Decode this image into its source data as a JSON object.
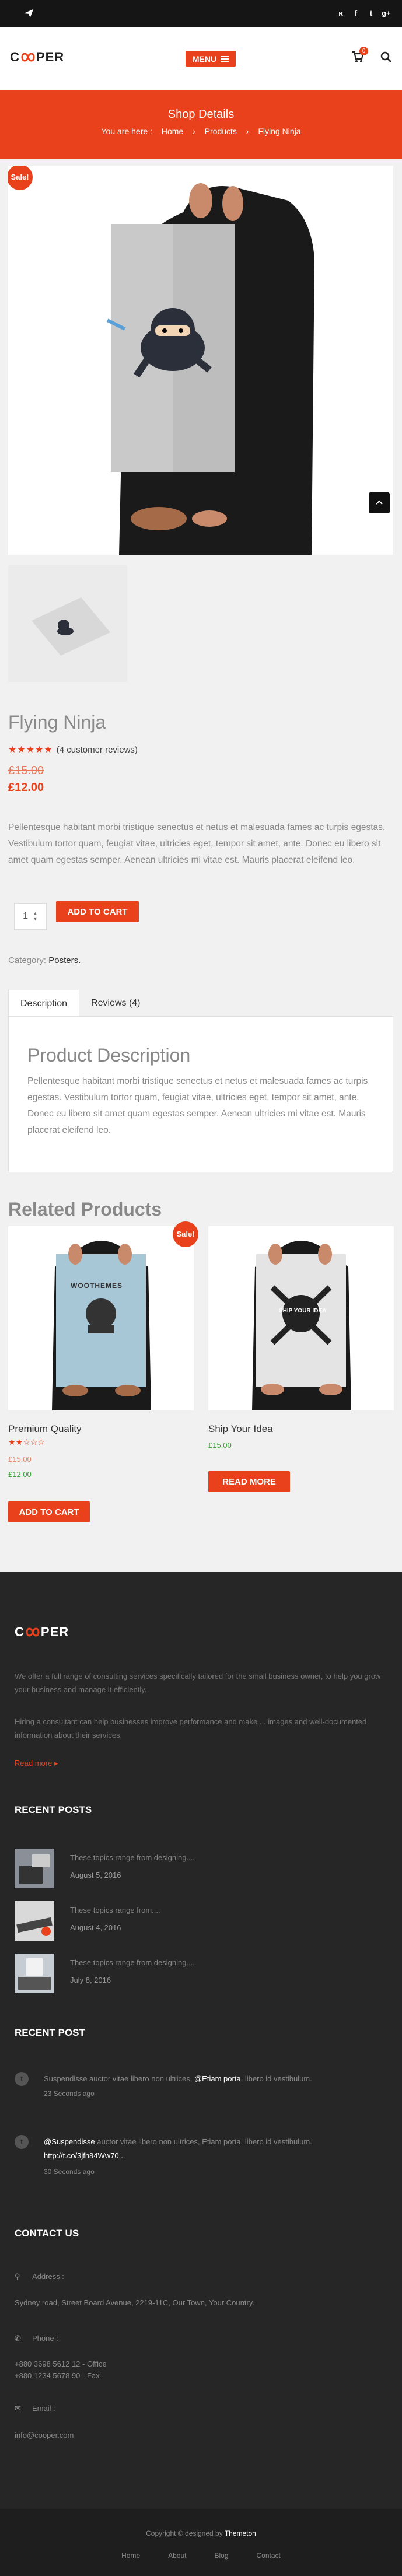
{
  "topbar": {
    "icons": [
      "send-icon",
      "rss-icon",
      "facebook-icon",
      "twitter-icon",
      "google-plus-icon"
    ],
    "glyphs": [
      "◢",
      "ʀ",
      "f",
      "t",
      "g+"
    ]
  },
  "header": {
    "logo_left": "C",
    "logo_right": "PER",
    "menu_label": "MENU",
    "cart_count": "0"
  },
  "banner": {
    "title": "Shop Details",
    "breadcrumb": {
      "prefix": "You are here :",
      "home": "Home",
      "sep1": "›",
      "products": "Products",
      "sep2": "›",
      "current": "Flying Ninja"
    }
  },
  "product": {
    "sale_badge": "Sale!",
    "title": "Flying Ninja",
    "stars": "★★★★★",
    "rating": 4,
    "reviews": "(4 customer reviews)",
    "old_price": "£15.00",
    "new_price": "£12.00",
    "description": "Pellentesque habitant morbi tristique senectus et netus et malesuada fames ac turpis egestas. Vestibulum tortor quam, feugiat vitae, ultricies eget, tempor sit amet, ante. Donec eu libero sit amet quam egestas semper. Aenean ultricies mi vitae est. Mauris placerat eleifend leo.",
    "qty": "1",
    "add_to_cart": "ADD TO CART",
    "category_label": "Category:",
    "category_value": "Posters."
  },
  "tabs": {
    "description": "Description",
    "reviews": "Reviews (4)",
    "panel_title": "Product Description",
    "panel_text": "Pellentesque habitant morbi tristique senectus et netus et malesuada fames ac turpis egestas. Vestibulum tortor quam, feugiat vitae, ultricies eget, tempor sit amet, ante. Donec eu libero sit amet quam egestas semper. Aenean ultricies mi vitae est. Mauris placerat eleifend leo."
  },
  "related": {
    "title": "Related Products",
    "items": [
      {
        "name": "Premium Quality",
        "stars": "★★☆☆☆",
        "rating": 2,
        "old": "£15.00",
        "new": "£12.00",
        "sale": "Sale!",
        "button": "ADD TO CART",
        "poster_text": "WOOTHEMES"
      },
      {
        "name": "Ship Your Idea",
        "price": "£15.00",
        "button": "READ MORE",
        "poster_text": "SHIP YOUR IDEA"
      }
    ]
  },
  "footer": {
    "logo_left": "C",
    "logo_right": "PER",
    "about1": "We offer a full range of consulting services specifically tailored for the small business owner, to help you grow your business and manage it efficiently.",
    "about2": "Hiring a consultant can help businesses improve performance and make ... images and well-documented information about their services.",
    "read_more": "Read more ▸",
    "recent_posts_title": "RECENT POSTS",
    "posts": [
      {
        "title": "These topics range from designing....",
        "date": "August 5, 2016"
      },
      {
        "title": "These topics range from....",
        "date": "August 4, 2016"
      },
      {
        "title": "These topics range from designing....",
        "date": "July 8, 2016"
      }
    ],
    "recent_post_title": "RECENT POST",
    "tweets": [
      {
        "pre": "Suspendisse auctor vitae libero non ultrices, ",
        "handle": "@Etiam porta",
        "post": ", libero id vestibulum.",
        "time": "23 Seconds ago"
      },
      {
        "pre": "",
        "handle": "@Suspendisse",
        "post": " auctor vitae libero non ultrices, Etiam porta, libero id vestibulum.",
        "link": "http://t.co/3jfh84Ww70...",
        "time": "30 Seconds ago"
      }
    ],
    "contact_title": "CONTACT US",
    "address_label": "Address :",
    "address": "Sydney road, Street Board Avenue, 2219-11C, Our Town, Your Country.",
    "phone_label": "Phone :",
    "phone1": "+880 3698 5612 12 - Office",
    "phone2": "+880 1234 5678 90 - Fax",
    "email_label": "Email :",
    "email": "info@cooper.com"
  },
  "bottom": {
    "copyright_pre": "Copyright © designed by ",
    "copyright_brand": "Themeton",
    "links": [
      "Home",
      "About",
      "Blog",
      "Contact"
    ]
  }
}
